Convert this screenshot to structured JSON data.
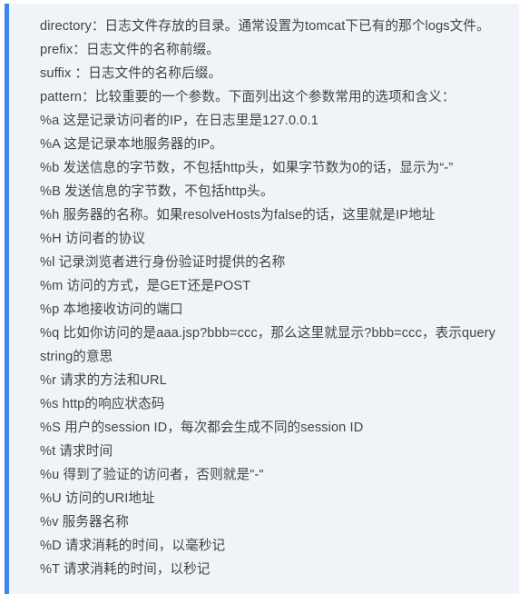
{
  "panel": {
    "kind": "blockquote-note",
    "accent_color": "#3d85e8",
    "background_color": "#f0f3f8",
    "text_color": "#404448"
  },
  "note": {
    "config_lines": [
      "directory：日志文件存放的目录。通常设置为tomcat下已有的那个logs文件。",
      "prefix：日志文件的名称前缀。",
      "suffix ：日志文件的名称后缀。",
      "pattern：比较重要的一个参数。下面列出这个参数常用的选项和含义："
    ],
    "pattern_options": [
      "%a   这是记录访问者的IP，在日志里是127.0.0.1",
      "%A   这是记录本地服务器的IP。",
      "%b   发送信息的字节数，不包括http头，如果字节数为0的话，显示为“-”",
      "%B   发送信息的字节数，不包括http头。",
      "%h   服务器的名称。如果resolveHosts为false的话，这里就是IP地址",
      "%H   访问者的协议",
      "%l   记录浏览者进行身份验证时提供的名称",
      "%m   访问的方式，是GET还是POST",
      "%p   本地接收访问的端口",
      "%q   比如你访问的是aaa.jsp?bbb=ccc，那么这里就显示?bbb=ccc，表示query string的意思",
      "%r   请求的方法和URL",
      "%s   http的响应状态码",
      "%S   用户的session ID，每次都会生成不同的session ID",
      "%t   请求时间",
      "%u   得到了验证的访问者，否则就是\"-\"",
      "%U   访问的URI地址",
      "%v   服务器名称",
      "%D   请求消耗的时间，以毫秒记",
      "%T   请求消耗的时间，以秒记"
    ]
  }
}
